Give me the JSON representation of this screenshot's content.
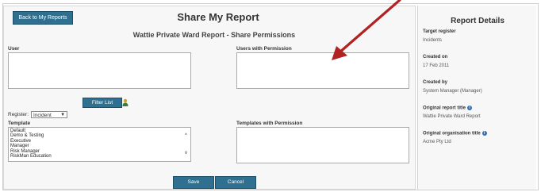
{
  "toolbar": {
    "back_label": "Back to My Reports"
  },
  "page": {
    "title": "Share My Report",
    "subtitle": "Wattie Private Ward Report - Share Permissions"
  },
  "user_section": {
    "user_label": "User",
    "users_with_permission_label": "Users with Permission",
    "filter_button_label": "Filter List"
  },
  "register": {
    "label": "Register:",
    "selected": "Incident"
  },
  "templates": {
    "label": "Template",
    "items": [
      "Default",
      "Demo & Testing",
      "Executive",
      "Manager",
      "Risk Manager",
      "RiskMan Education"
    ],
    "with_permission_label": "Templates with Permission"
  },
  "actions": {
    "save_label": "Save",
    "cancel_label": "Cancel"
  },
  "details": {
    "title": "Report Details",
    "target_register_label": "Target register",
    "target_register_value": "Incidents",
    "created_on_label": "Created on",
    "created_on_value": "17 Feb 2011",
    "created_by_label": "Created by",
    "created_by_value": "System Manager (Manager)",
    "orig_title_label": "Original report title",
    "orig_title_value": "Wattie Private Ward Report",
    "orig_org_label": "Original organisation title",
    "orig_org_value": "Acme Pty Ltd"
  },
  "colors": {
    "button_blue": "#2f6f8f",
    "arrow_red": "#b22222"
  }
}
